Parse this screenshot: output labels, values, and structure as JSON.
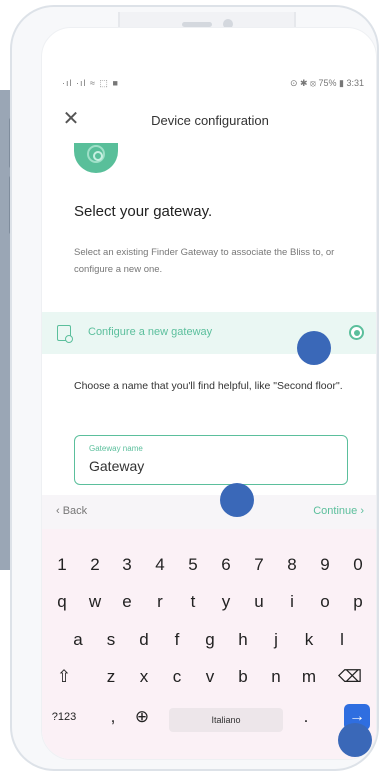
{
  "status_bar": {
    "left": "·ıl ·ıl ≈ ⬚ ■",
    "right": "⊙ ✱ ⦻ 75% ▮ 3:31"
  },
  "app_bar": {
    "close_icon": "close-icon",
    "title": "Device configuration"
  },
  "content": {
    "heading": "Select your gateway.",
    "description": "Select an existing Finder Gateway to associate the Bliss to, or configure a new one.",
    "option": {
      "label": "Configure a new gateway",
      "selected": true
    },
    "hint": "Choose a name that you'll find helpful, like \"Second floor\".",
    "field": {
      "label": "Gateway name",
      "value": "Gateway"
    }
  },
  "accessory": {
    "back": "‹  Back",
    "continue": "Continue  ›"
  },
  "keyboard": {
    "row_numbers": [
      "1",
      "2",
      "3",
      "4",
      "5",
      "6",
      "7",
      "8",
      "9",
      "0"
    ],
    "row_top": [
      "q",
      "w",
      "e",
      "r",
      "t",
      "y",
      "u",
      "i",
      "o",
      "p"
    ],
    "row_middle": [
      "a",
      "s",
      "d",
      "f",
      "g",
      "h",
      "j",
      "k",
      "l"
    ],
    "row_bottom": [
      "z",
      "x",
      "c",
      "v",
      "b",
      "n",
      "m"
    ],
    "shift": "⇧",
    "backspace": "⌫",
    "symbols": "?123",
    "comma": ",",
    "globe": "⊕",
    "space": "Italiano",
    "period": ".",
    "enter": "→"
  },
  "colors": {
    "accent": "#5bbf9c",
    "enter": "#2f6ee0",
    "touch_dot": "#3a68b8"
  }
}
